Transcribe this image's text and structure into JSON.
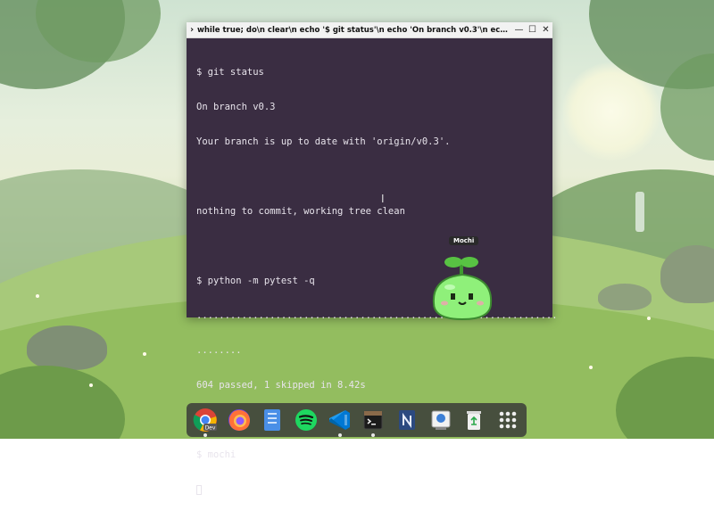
{
  "terminal": {
    "title": "while true; do\\n clear\\n echo '$ git status'\\n echo 'On branch v0.3'\\n echo ...",
    "lines": [
      "$ git status",
      "On branch v0.3",
      "Your branch is up to date with 'origin/v0.3'.",
      "",
      "nothing to commit, working tree clean",
      "",
      "$ python -m pytest -q",
      "................................................................",
      "........",
      "604 passed, 1 skipped in 8.42s",
      "",
      "$ mochi"
    ],
    "controls": {
      "minimize": "—",
      "maximize": "☐",
      "close": "✕"
    }
  },
  "pet": {
    "name": "Mochi"
  },
  "dock": {
    "apps": [
      {
        "name": "Chrome Dev",
        "badge": "Dev",
        "running": true
      },
      {
        "name": "Firefox",
        "running": false
      },
      {
        "name": "Files",
        "running": false
      },
      {
        "name": "Spotify",
        "running": false
      },
      {
        "name": "VS Code",
        "running": true
      },
      {
        "name": "Terminal",
        "running": true
      },
      {
        "name": "Notion",
        "running": false
      },
      {
        "name": "Preview",
        "running": false
      },
      {
        "name": "Recycle Bin",
        "running": false
      },
      {
        "name": "App Grid",
        "running": false
      }
    ]
  },
  "colors": {
    "terminal_bg": "#3a2d42",
    "terminal_fg": "#e8e4ec",
    "mochi_green": "#8ff07a"
  }
}
